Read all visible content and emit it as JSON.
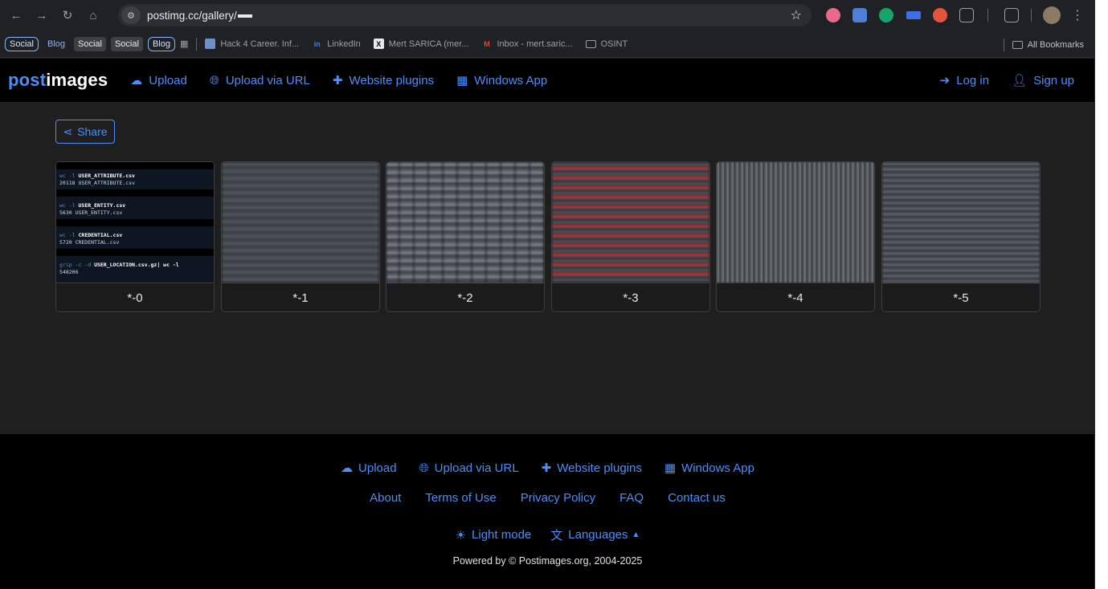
{
  "browser": {
    "url": "postimg.cc/gallery/",
    "bookmarks": {
      "chips": [
        "Social",
        "Blog",
        "Social",
        "Social",
        "Blog"
      ],
      "items": [
        {
          "label": "Hack 4 Career. Inf...",
          "icon": "hack4career-icon"
        },
        {
          "label": "LinkedIn",
          "icon": "linkedin-icon"
        },
        {
          "label": "Mert SARICA (mer...",
          "icon": "x-icon"
        },
        {
          "label": "Inbox - mert.saric...",
          "icon": "gmail-icon"
        },
        {
          "label": "OSINT",
          "icon": "folder-icon"
        }
      ],
      "all": "All Bookmarks"
    }
  },
  "nav": {
    "logo_post": "post",
    "logo_images": "images",
    "links": [
      "Upload",
      "Upload via URL",
      "Website plugins",
      "Windows App"
    ],
    "login": "Log in",
    "signup": "Sign up"
  },
  "gallery": {
    "share": "Share",
    "items": [
      "*-0",
      "*-1",
      "*-2",
      "*-3",
      "*-4",
      "*-5"
    ],
    "thumb0_lines": [
      {
        "cmd": "wc -l",
        "arg": "USER_ATTRIBUTE.csv",
        "out": "20118 USER_ATTRIBUTE.csv"
      },
      {
        "cmd": "wc -l",
        "arg": "USER_ENTITY.csv",
        "out": "5630 USER_ENTITY.csv"
      },
      {
        "cmd": "wc -l",
        "arg": "CREDENTIAL.csv",
        "out": "5720 CREDENTIAL.csv"
      },
      {
        "cmd": "grip -c -d",
        "arg": "USER_LOCATION.csv.gz| wc -l",
        "out": "548206"
      }
    ]
  },
  "footer": {
    "links_row1": [
      "Upload",
      "Upload via URL",
      "Website plugins",
      "Windows App"
    ],
    "links_row2": [
      "About",
      "Terms of Use",
      "Privacy Policy",
      "FAQ",
      "Contact us"
    ],
    "light_mode": "Light mode",
    "languages": "Languages",
    "copyright": "Powered by © Postimages.org, 2004-2025"
  },
  "colors": {
    "accent": "#4f8ef7",
    "page_bg": "#1f1f1f",
    "nav_bg": "#000000"
  }
}
